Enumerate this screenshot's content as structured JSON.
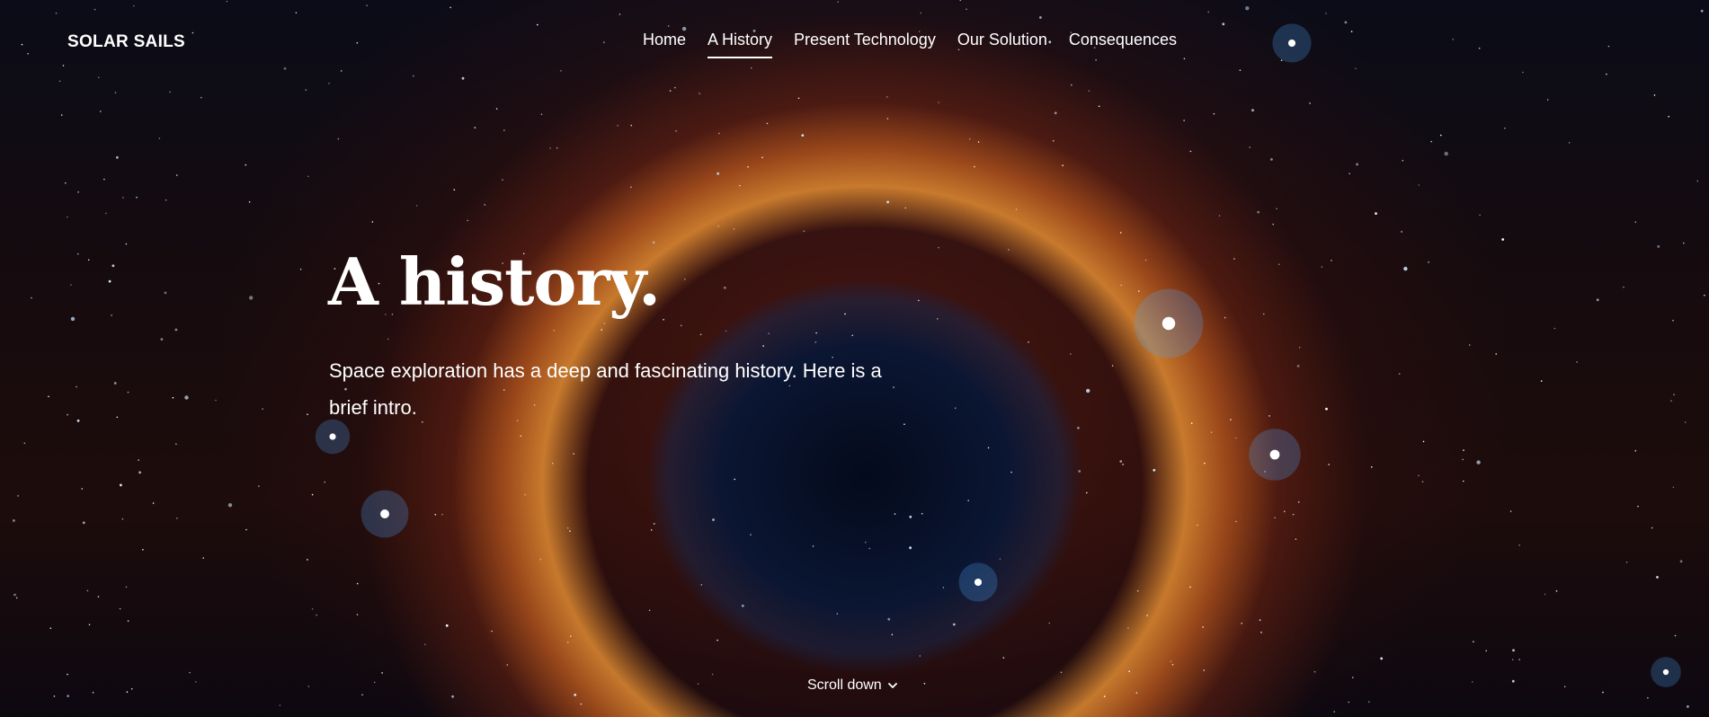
{
  "brand": "SOLAR SAILS",
  "nav": {
    "items": [
      {
        "label": "Home",
        "active": false
      },
      {
        "label": "A History",
        "active": true
      },
      {
        "label": "Present Technology",
        "active": false
      },
      {
        "label": "Our Solution",
        "active": false
      },
      {
        "label": "Consequences",
        "active": false
      }
    ]
  },
  "hero": {
    "title": "A history.",
    "text_line1": "Space exploration has a deep and fascinating history. Here is a",
    "text_line2": "brief intro."
  },
  "scroll": {
    "label": "Scroll down",
    "icon": "chevron-down-icon"
  },
  "colors": {
    "text": "#ffffff",
    "background": "#05060c",
    "nebula_orange": "#e28c32",
    "nebula_core": "#08163a"
  }
}
